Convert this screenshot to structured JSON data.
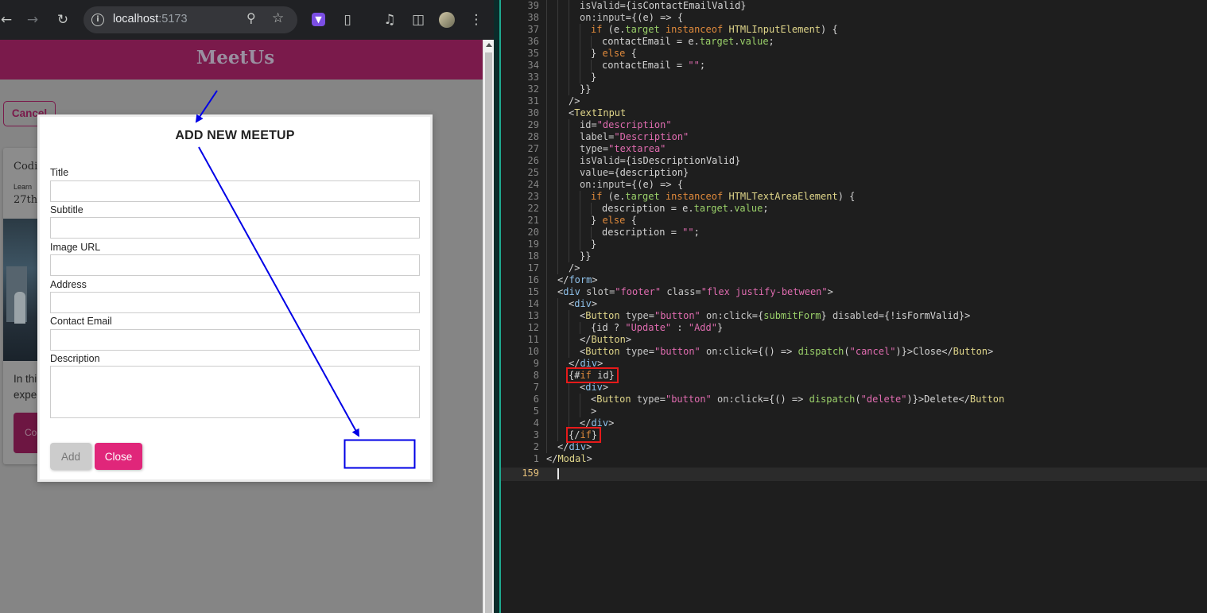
{
  "browser": {
    "url_host": "localhost",
    "url_port": ":5173",
    "icons": [
      "back-icon",
      "forward-icon",
      "reload-icon",
      "info-icon",
      "zoom-icon",
      "star-icon",
      "extension-icon",
      "puzzle-icon",
      "media-icon",
      "sidepanel-icon",
      "profile-icon",
      "menu-icon"
    ]
  },
  "app": {
    "title": "MeetUs",
    "background": {
      "cancel_label": "Cancel",
      "card_title": "Codin",
      "card_subtitle": "Learn",
      "card_date": "27th",
      "card_text_1": "In thi",
      "card_text_2": "expe",
      "card_button": "Co"
    }
  },
  "modal": {
    "title": "ADD NEW MEETUP",
    "fields": [
      {
        "label": "Title",
        "value": ""
      },
      {
        "label": "Subtitle",
        "value": ""
      },
      {
        "label": "Image URL",
        "value": ""
      },
      {
        "label": "Address",
        "value": ""
      },
      {
        "label": "Contact Email",
        "value": ""
      },
      {
        "label": "Description",
        "value": ""
      }
    ],
    "add_label": "Add",
    "close_label": "Close"
  },
  "colors": {
    "header": "#7a1a4b",
    "primary": "#e0267a",
    "annotation": "#0000e6",
    "highlight": "#e61a1a"
  },
  "editor": {
    "cursor_line_number": "159",
    "lines": [
      {
        "n": "39",
        "i": 3,
        "h": "<span class=\"a\">isValid</span>={isContactEmailValid}"
      },
      {
        "n": "38",
        "i": 3,
        "h": "<span class=\"a\">on:input</span>={(e) => {"
      },
      {
        "n": "37",
        "i": 4,
        "h": "<span class=\"k\">if</span> (e.<span class=\"c\">target</span> <span class=\"k\">instanceof</span> <span class=\"y\">HTMLInputElement</span>) {"
      },
      {
        "n": "36",
        "i": 5,
        "h": "contactEmail = e.<span class=\"c\">target</span>.<span class=\"c\">value</span>;"
      },
      {
        "n": "35",
        "i": 4,
        "h": "} <span class=\"k\">else</span> {"
      },
      {
        "n": "34",
        "i": 5,
        "h": "contactEmail = <span class=\"s\">\"\"</span>;"
      },
      {
        "n": "33",
        "i": 4,
        "h": "}"
      },
      {
        "n": "32",
        "i": 3,
        "h": "}}"
      },
      {
        "n": "31",
        "i": 2,
        "h": "/>"
      },
      {
        "n": "30",
        "i": 2,
        "h": "&lt;<span class=\"y\">TextInput</span>"
      },
      {
        "n": "29",
        "i": 3,
        "h": "<span class=\"a\">id</span>=<span class=\"s\">\"description\"</span>"
      },
      {
        "n": "28",
        "i": 3,
        "h": "<span class=\"a\">label</span>=<span class=\"s\">\"Description\"</span>"
      },
      {
        "n": "27",
        "i": 3,
        "h": "<span class=\"a\">type</span>=<span class=\"s\">\"textarea\"</span>"
      },
      {
        "n": "26",
        "i": 3,
        "h": "<span class=\"a\">isValid</span>={isDescriptionValid}"
      },
      {
        "n": "25",
        "i": 3,
        "h": "<span class=\"a\">value</span>={description}"
      },
      {
        "n": "24",
        "i": 3,
        "h": "<span class=\"a\">on:input</span>={(e) => {"
      },
      {
        "n": "23",
        "i": 4,
        "h": "<span class=\"k\">if</span> (e.<span class=\"c\">target</span> <span class=\"k\">instanceof</span> <span class=\"y\">HTMLTextAreaElement</span>) {"
      },
      {
        "n": "22",
        "i": 5,
        "h": "description = e.<span class=\"c\">target</span>.<span class=\"c\">value</span>;"
      },
      {
        "n": "21",
        "i": 4,
        "h": "} <span class=\"k\">else</span> {"
      },
      {
        "n": "20",
        "i": 5,
        "h": "description = <span class=\"s\">\"\"</span>;"
      },
      {
        "n": "19",
        "i": 4,
        "h": "}"
      },
      {
        "n": "18",
        "i": 3,
        "h": "}}"
      },
      {
        "n": "17",
        "i": 2,
        "h": "/>"
      },
      {
        "n": "16",
        "i": 1,
        "h": "&lt;/<span class=\"t\">form</span>&gt;"
      },
      {
        "n": "15",
        "i": 1,
        "h": "&lt;<span class=\"t\">div</span> <span class=\"a\">slot</span>=<span class=\"s\">\"footer\"</span> <span class=\"a\">class</span>=<span class=\"s\">\"flex justify-between\"</span>&gt;"
      },
      {
        "n": "14",
        "i": 2,
        "h": "&lt;<span class=\"t\">div</span>&gt;"
      },
      {
        "n": "13",
        "i": 3,
        "h": "&lt;<span class=\"y\">Button</span> <span class=\"a\">type</span>=<span class=\"s\">\"button\"</span> <span class=\"a\">on:click</span>={<span class=\"c\">submitForm</span>} <span class=\"a\">disabled</span>={!isFormValid}&gt;"
      },
      {
        "n": "12",
        "i": 4,
        "h": "{id ? <span class=\"s\">\"Update\"</span> : <span class=\"s\">\"Add\"</span>}"
      },
      {
        "n": "11",
        "i": 3,
        "h": "&lt;/<span class=\"y\">Button</span>&gt;"
      },
      {
        "n": "10",
        "i": 3,
        "h": "&lt;<span class=\"y\">Button</span> <span class=\"a\">type</span>=<span class=\"s\">\"button\"</span> <span class=\"a\">on:click</span>={() => <span class=\"c\">dispatch</span>(<span class=\"s\">\"cancel\"</span>)}&gt;Close&lt;/<span class=\"y\">Button</span>&gt;"
      },
      {
        "n": "9",
        "i": 2,
        "h": "&lt;/<span class=\"t\">div</span>&gt;"
      },
      {
        "n": "8",
        "i": 2,
        "h": "{#<span class=\"k\">if</span> id}"
      },
      {
        "n": "7",
        "i": 3,
        "h": "&lt;<span class=\"t\">div</span>&gt;"
      },
      {
        "n": "6",
        "i": 4,
        "h": "&lt;<span class=\"y\">Button</span> <span class=\"a\">type</span>=<span class=\"s\">\"button\"</span> <span class=\"a\">on:click</span>={() => <span class=\"c\">dispatch</span>(<span class=\"s\">\"delete\"</span>)}&gt;Delete&lt;/<span class=\"y\">Button</span>"
      },
      {
        "n": "5",
        "i": 4,
        "h": "&gt;"
      },
      {
        "n": "4",
        "i": 3,
        "h": "&lt;/<span class=\"t\">div</span>&gt;"
      },
      {
        "n": "3",
        "i": 2,
        "h": "{/<span class=\"k\">if</span>}"
      },
      {
        "n": "2",
        "i": 1,
        "h": "&lt;/<span class=\"t\">div</span>&gt;"
      },
      {
        "n": "1",
        "i": 0,
        "h": "&lt;/<span class=\"y\">Modal</span>&gt;"
      }
    ]
  }
}
